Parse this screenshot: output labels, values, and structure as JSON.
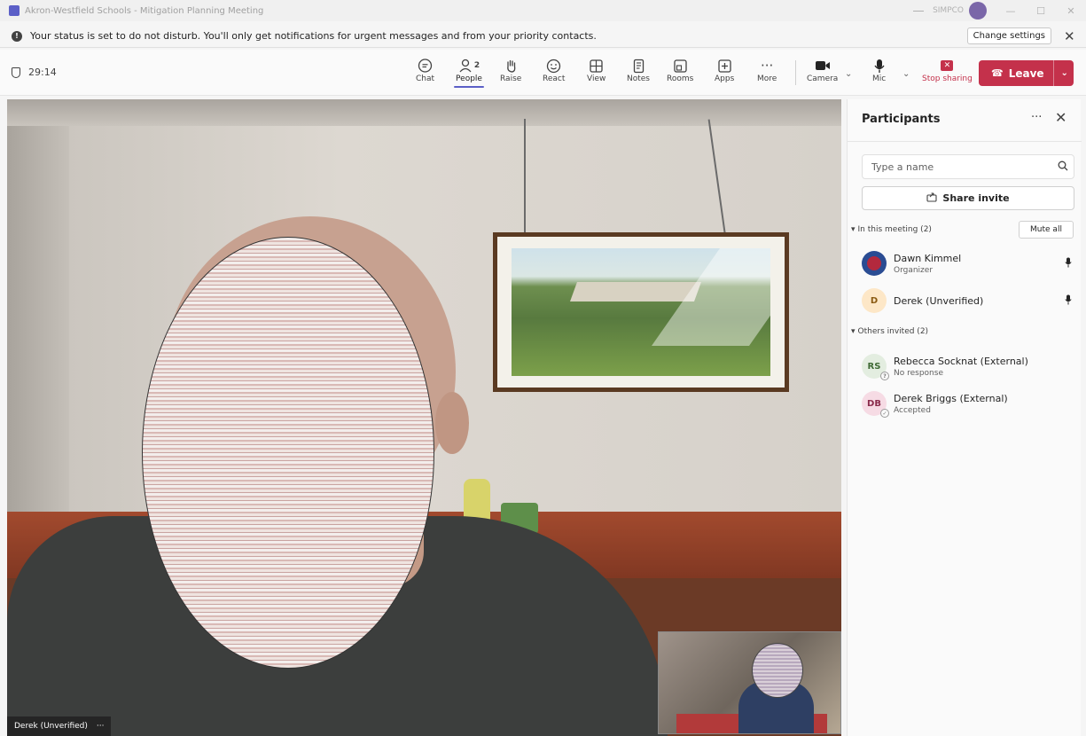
{
  "window": {
    "title": "Akron-Westfield Schools - Mitigation Planning Meeting",
    "org_label": "SIMPCO"
  },
  "banner": {
    "message": "Your status is set to do not disturb. You'll only get notifications for urgent messages and from your priority contacts.",
    "change_settings_label": "Change settings"
  },
  "toolbar": {
    "timer": "29:14",
    "buttons": {
      "chat": "Chat",
      "people": "People",
      "people_count": "2",
      "raise": "Raise",
      "react": "React",
      "view": "View",
      "notes": "Notes",
      "rooms": "Rooms",
      "apps": "Apps",
      "more": "More",
      "camera": "Camera",
      "mic": "Mic",
      "stop_sharing": "Stop sharing"
    },
    "leave_label": "Leave"
  },
  "video": {
    "main_name": "Derek (Unverified)",
    "main_menu": "···"
  },
  "participants_panel": {
    "title": "Participants",
    "more_label": "···",
    "search_placeholder": "Type a name",
    "share_invite_label": "Share invite",
    "in_meeting_label": "In this meeting (2)",
    "mute_all_label": "Mute all",
    "in_meeting": [
      {
        "initials": "",
        "name": "Dawn Kimmel",
        "role": "Organizer"
      },
      {
        "initials": "D",
        "name": "Derek (Unverified)",
        "role": ""
      }
    ],
    "others_invited_label": "Others invited (2)",
    "others_invited": [
      {
        "initials": "RS",
        "name": "Rebecca Socknat (External)",
        "status": "No response"
      },
      {
        "initials": "DB",
        "name": "Derek Briggs (External)",
        "status": "Accepted"
      }
    ]
  },
  "colors": {
    "leave": "#c4314b",
    "accent": "#5b5fc7",
    "stop_sharing": "#c4314b"
  }
}
